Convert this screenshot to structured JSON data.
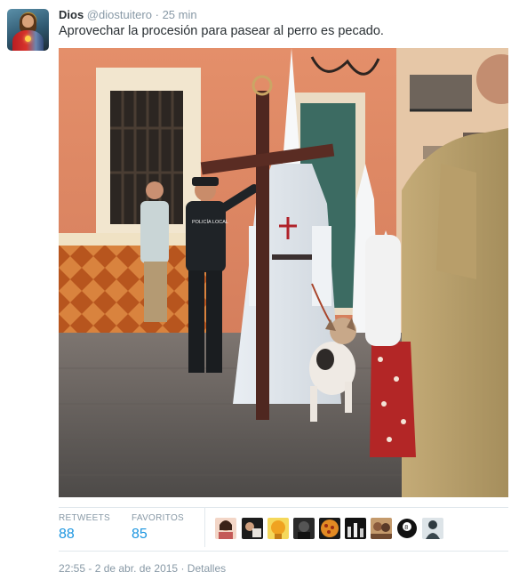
{
  "tweet": {
    "author_name": "Dios",
    "author_handle": "@diostuitero",
    "separator": "·",
    "time_ago": "25 min",
    "text": "Aprovechar la procesión para pasear al perro es pecado."
  },
  "photo": {
    "police_badge_text": "POLICÍA LOCAL"
  },
  "stats": {
    "retweets_label": "RETWEETS",
    "retweets_count": "88",
    "favorites_label": "FAVORITOS",
    "favorites_count": "85",
    "favorited_by_avatars": [
      {
        "icon": "woman-avatar-icon"
      },
      {
        "icon": "photo-avatar-icon"
      },
      {
        "icon": "yellow-avatar-icon"
      },
      {
        "icon": "dark-avatar-icon"
      },
      {
        "icon": "pizza-avatar-icon"
      },
      {
        "icon": "crowd-avatar-icon"
      },
      {
        "icon": "people-avatar-icon"
      },
      {
        "icon": "eight-ball-avatar-icon"
      },
      {
        "icon": "figure-avatar-icon"
      }
    ]
  },
  "footer": {
    "timestamp": "22:55 - 2 de abr. de 2015",
    "separator": "·",
    "details_link": "Detalles"
  },
  "colors": {
    "link_blue": "#1b95e0",
    "muted_gray": "#8899a6",
    "text_dark": "#292f33",
    "divider": "#e1e8ed"
  }
}
